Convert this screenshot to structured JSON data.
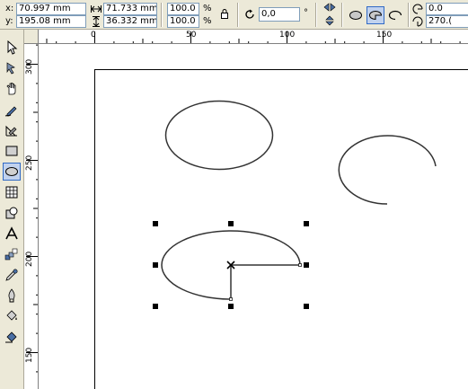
{
  "propbar": {
    "x_label": "x:",
    "x_value": "70.997 mm",
    "y_label": "y:",
    "y_value": "195.08 mm",
    "width_value": "71.733 mm",
    "height_value": "36.332 mm",
    "scale_x": "100.0",
    "scale_y": "100.0",
    "percent_symbol": "%",
    "rotation_value": "0,0",
    "degree_symbol": "°",
    "start_angle": "0.0",
    "end_angle": "270.("
  },
  "hruler": {
    "labels": [
      "0",
      "50",
      "100",
      "150"
    ]
  },
  "vruler": {
    "labels": [
      "300",
      "250",
      "200",
      "150"
    ]
  },
  "toolbox": {
    "tools": [
      "pick-tool-icon",
      "shape-tool-icon",
      "zoom-tool-icon",
      "freehand-tool-icon",
      "smart-fill-tool-icon",
      "rectangle-tool-icon",
      "ellipse-tool-icon",
      "graph-paper-tool-icon",
      "basic-shapes-tool-icon",
      "text-tool-icon",
      "interactive-blend-tool-icon",
      "eyedropper-tool-icon",
      "outline-tool-icon",
      "fill-tool-icon",
      "interactive-fill-tool-icon"
    ],
    "active": "ellipse-tool-icon"
  },
  "colors": {
    "ui_face": "#ece9d8",
    "selection_blue": "#316ac5",
    "shape_stroke": "#333333"
  }
}
